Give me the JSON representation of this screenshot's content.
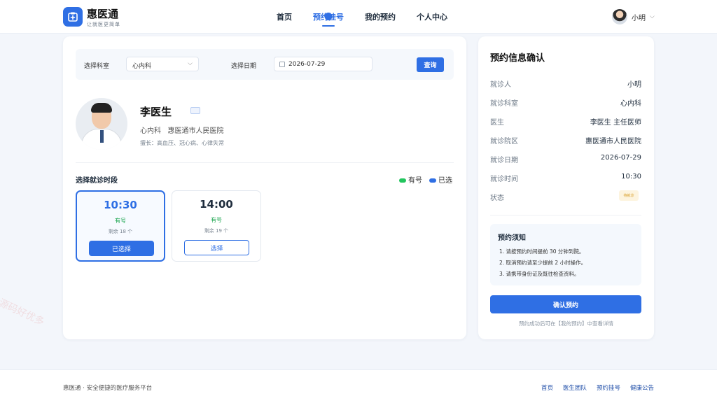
{
  "header": {
    "brand_name": "惠医通",
    "brand_slogan": "让就医更简单",
    "nav": [
      "首页",
      "预约挂号",
      "我的预约",
      "个人中心"
    ],
    "user_name": "小明"
  },
  "filter": {
    "dept_label": "选择科室",
    "dept_value": "心内科",
    "date_label": "选择日期",
    "date_value": "2026-07-29",
    "query_label": "查询"
  },
  "doctor": {
    "name": "李医生",
    "dept": "心内科",
    "hospital": "惠医通市人民医院",
    "specialty": "擅长：高血压、冠心病、心律失常"
  },
  "slots_section": {
    "title": "选择就诊时段",
    "legend_available": "有号",
    "legend_selected": "已选",
    "legend_available_color": "#22c55e",
    "legend_selected_color": "#2f6fe4"
  },
  "slots": [
    {
      "time": "10:30",
      "status": "有号",
      "remain": "剩余 18 个",
      "button": "已选择"
    },
    {
      "time": "14:00",
      "status": "有号",
      "remain": "剩余 19 个",
      "button": "选择"
    }
  ],
  "confirm": {
    "title": "预约信息确认",
    "rows": [
      {
        "k": "就诊人",
        "v": "小明"
      },
      {
        "k": "就诊科室",
        "v": "心内科"
      },
      {
        "k": "医生",
        "v": "李医生 主任医师"
      },
      {
        "k": "就诊院区",
        "v": "惠医通市人民医院"
      },
      {
        "k": "就诊日期",
        "v": "2026-07-29"
      },
      {
        "k": "就诊时间",
        "v": "10:30"
      },
      {
        "k": "状态",
        "v": "待就诊"
      }
    ],
    "notice_title": "预约须知",
    "notice_lines": [
      "1. 请按预约时间提前 30 分钟到院。",
      "2. 取消预约请至少提前 2 小时操作。",
      "3. 请携带身份证及既往检查资料。"
    ],
    "confirm_button": "确认预约",
    "hint": "预约成功后可在【我的预约】中查看详情"
  },
  "footer": {
    "left": "惠医通 · 安全便捷的医疗服务平台",
    "links": [
      "首页",
      "医生团队",
      "预约挂号",
      "健康公告"
    ]
  },
  "watermark": "源码好优多"
}
